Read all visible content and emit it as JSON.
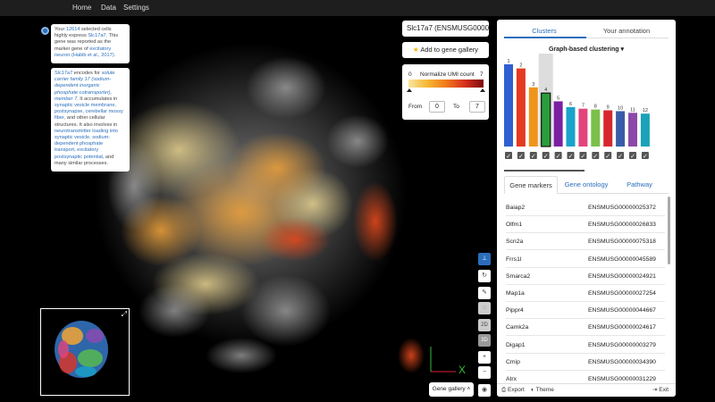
{
  "topbar": {
    "nav": [
      "Home",
      "Data",
      "Settings"
    ]
  },
  "info_box_1": {
    "line1_prefix": "Your",
    "count": "12614",
    "line1_suffix": "selected cells",
    "line2_prefix": "highly express",
    "gene": "Slc17a7.",
    "line2_suffix": "This",
    "line3": "gene was reported as the",
    "line4_prefix": "marker gene of",
    "marker": "excitatory",
    "line5_cell": "neuron",
    "line5_ref": "(Habib et al., 2017)."
  },
  "info_box_2": {
    "gene": "Slc17a7",
    "encodes": "encodes for",
    "family1": "solute",
    "family2": "carrier family 17 (sodium-",
    "family3": "dependent inorganic",
    "family4": "phosphate cotransporter),",
    "family5": "member 7.",
    "t1": "It accumulates in",
    "t2": "synaptic vesicle membrane,",
    "t3": "postsynapse, cerebellar mossy",
    "t4": "fiber,",
    "t4b": "and other cellular",
    "t5": "structures. It also involves in",
    "t6": "neurotransmitter loading into",
    "t7": "synaptic vesicle, sodium-",
    "t8": "dependent phosphate",
    "t9": "transport, excitatory",
    "t10": "postsynaptic potential,",
    "t10b": "and",
    "t11": "many similar processes."
  },
  "gene_search": {
    "value": "Slc17a7 (ENSMUSG000000"
  },
  "add_gallery": {
    "icon": "star-icon",
    "label": "Add to gene gallery"
  },
  "color_scale": {
    "min": "0",
    "max": "7",
    "label": "Normalize UMI count",
    "from_label": "From",
    "from_value": "0",
    "to_label": "To",
    "to_value": "7"
  },
  "panel": {
    "tabs": [
      "Clusters",
      "Your annotation"
    ],
    "chart_title": "Graph-based clustering",
    "marker_tabs": [
      "Gene markers",
      "Gene ontology",
      "Pathway"
    ],
    "gene_markers": [
      {
        "name": "Baiap2",
        "id": "ENSMUSG00000025372"
      },
      {
        "name": "Olfm1",
        "id": "ENSMUSG00000026833"
      },
      {
        "name": "Scn2a",
        "id": "ENSMUSG00000075318"
      },
      {
        "name": "Frrs1l",
        "id": "ENSMUSG00000045589"
      },
      {
        "name": "Smarca2",
        "id": "ENSMUSG00000024921"
      },
      {
        "name": "Map1a",
        "id": "ENSMUSG00000027254"
      },
      {
        "name": "Pippr4",
        "id": "ENSMUSG00000044667"
      },
      {
        "name": "Camk2a",
        "id": "ENSMUSG00000024617"
      },
      {
        "name": "Digap1",
        "id": "ENSMUSG00000003279"
      },
      {
        "name": "Cmip",
        "id": "ENSMUSG00000034390"
      },
      {
        "name": "Atrx",
        "id": "ENSMUSG00000031229"
      }
    ],
    "export_label": "Export",
    "theme_label": "Theme",
    "exit_label": "Exit"
  },
  "toolbar": {
    "mode_2d": "2D",
    "mode_3d": "3D",
    "zoom_in": "+",
    "zoom_out": "−"
  },
  "gene_gallery_button": "Gene gallery",
  "chart_data": {
    "type": "bar",
    "title": "Graph-based clustering",
    "categories": [
      "1",
      "2",
      "3",
      "4",
      "5",
      "6",
      "7",
      "8",
      "9",
      "10",
      "11",
      "12"
    ],
    "values": [
      100,
      95,
      72,
      65,
      55,
      48,
      46,
      45,
      44,
      43,
      41,
      40
    ],
    "colors": [
      "#2f5fd0",
      "#e43a1f",
      "#f0951b",
      "#2a9d3b",
      "#7b1fa2",
      "#1aa3c9",
      "#e3457a",
      "#7cc04b",
      "#d6282e",
      "#3a5ca8",
      "#8b4aa8",
      "#19a2b8"
    ],
    "highlighted_category": "4",
    "legend": "none",
    "grid": false
  }
}
